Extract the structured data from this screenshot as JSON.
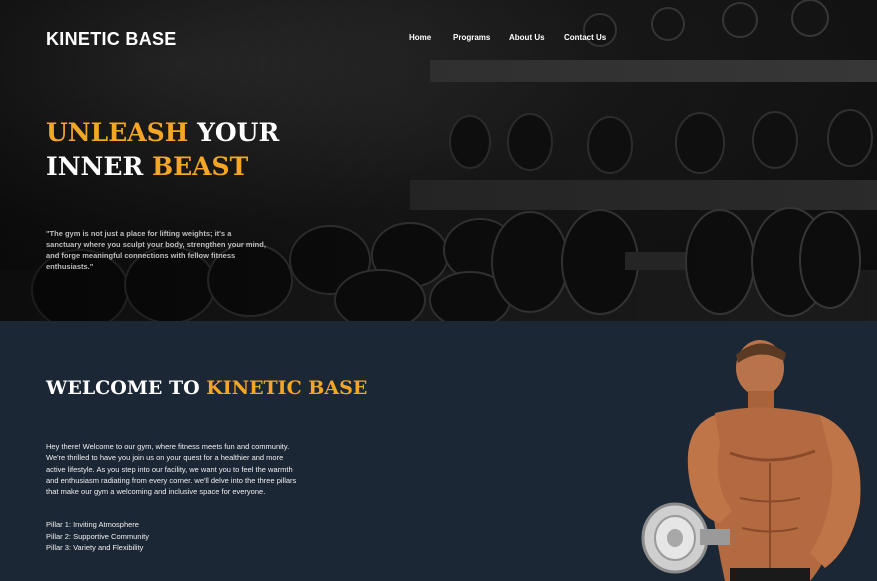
{
  "brand": {
    "name": "KINETIC BASE"
  },
  "nav": {
    "items": [
      {
        "label": "Home"
      },
      {
        "label": "Programs"
      },
      {
        "label": "About Us"
      },
      {
        "label": "Contact Us"
      }
    ]
  },
  "hero": {
    "title_part1_accent": "UNLEASH",
    "title_part2": " YOUR",
    "title_part3": "INNER ",
    "title_part4_accent": "BEAST",
    "quote": "\"The gym is not just a place for lifting weights; it's a sanctuary where you sculpt your body, strengthen your mind, and forge meaningful connections with fellow fitness enthusiasts.\""
  },
  "welcome": {
    "title_plain": "WELCOME TO ",
    "title_accent": "KINETIC BASE",
    "body": "Hey there! Welcome to our gym, where fitness meets fun and community. We're thrilled to have you join us on your quest for a healthier and more active lifestyle. As you step into our facility, we want you to feel the warmth and enthusiasm radiating from every corner. we'll delve into the three pillars that make our gym a welcoming and inclusive space for everyone.",
    "pillars": [
      "Pillar 1: Inviting Atmosphere",
      "Pillar 2: Supportive Community",
      "Pillar 3: Variety and Flexibility"
    ]
  },
  "colors": {
    "accent": "#f5a623",
    "section_bg": "#1b2735",
    "text": "#ffffff"
  }
}
